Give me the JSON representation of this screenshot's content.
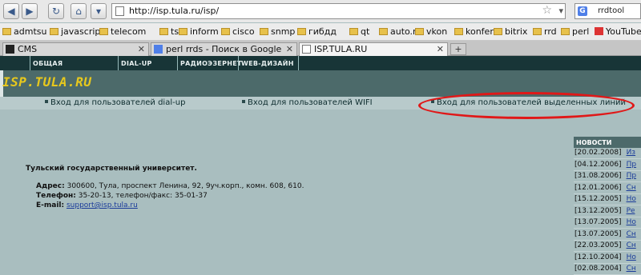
{
  "browser": {
    "url": "http://isp.tula.ru/isp/",
    "search_engine_icon": "G",
    "search_query": "rrdtool",
    "bookmarks": [
      {
        "label": "admtsu",
        "icon": "folder-icon"
      },
      {
        "label": "javascript",
        "icon": "folder-icon"
      },
      {
        "label": "telecom",
        "icon": "folder-icon"
      },
      {
        "label": "tsu",
        "icon": "folder-icon"
      },
      {
        "label": "inform",
        "icon": "folder-icon"
      },
      {
        "label": "cisco",
        "icon": "folder-icon"
      },
      {
        "label": "snmp",
        "icon": "folder-icon"
      },
      {
        "label": "гибдд",
        "icon": "folder-icon"
      },
      {
        "label": "qt",
        "icon": "folder-icon"
      },
      {
        "label": "auto.ru",
        "icon": "folder-icon"
      },
      {
        "label": "vkon",
        "icon": "folder-icon"
      },
      {
        "label": "konfer",
        "icon": "folder-icon"
      },
      {
        "label": "bitrix",
        "icon": "folder-icon"
      },
      {
        "label": "rrd",
        "icon": "folder-icon"
      },
      {
        "label": "perl",
        "icon": "folder-icon"
      },
      {
        "label": "YouTube - Брон",
        "icon": "youtube-icon"
      }
    ],
    "tabs": [
      {
        "label": "CMS"
      },
      {
        "label": "perl rrds - Поиск в Google"
      },
      {
        "label": "ISP.TULA.RU"
      }
    ],
    "new_tab_label": "+"
  },
  "site": {
    "nav": [
      {
        "label": "ОБЩАЯ ИНФОРМАЦИЯ"
      },
      {
        "label": "DIAL-UP"
      },
      {
        "label": "РАДИОЭЗЕРНЕТ"
      },
      {
        "label": "WEB-ДИЗАЙН"
      }
    ],
    "logo": "ISP.TULA.RU",
    "login_links": [
      {
        "label": "Вход для пользователей dial-up"
      },
      {
        "label": "Вход для пользователей WIFI"
      },
      {
        "label": "Вход для пользователей выделенных линий"
      }
    ],
    "university": "Тульский государственный университет.",
    "address_label": "Адрес:",
    "address": "300600, Тула, проспект Ленина, 92, 9уч.корп., комн. 608, 610.",
    "phone_label": "Телефон:",
    "phone": "35-20-13, телефон/факс: 35-01-37",
    "email_label": "E-mail:",
    "email": "support@isp.tula.ru",
    "news_header": "НОВОСТИ",
    "news": [
      {
        "date": "[20.02.2008]",
        "title": "Из"
      },
      {
        "date": "[04.12.2006]",
        "title": "Пр"
      },
      {
        "date": "[31.08.2006]",
        "title": "Пр"
      },
      {
        "date": "[12.01.2006]",
        "title": "Сн"
      },
      {
        "date": "[15.12.2005]",
        "title": "Но"
      },
      {
        "date": "[13.12.2005]",
        "title": "Ре"
      },
      {
        "date": "[13.07.2005]",
        "title": "Но"
      },
      {
        "date": "[13.07.2005]",
        "title": "Сн"
      },
      {
        "date": "[22.03.2005]",
        "title": "Сн"
      },
      {
        "date": "[12.10.2004]",
        "title": "Но"
      },
      {
        "date": "[02.08.2004]",
        "title": "Сн"
      }
    ]
  },
  "colors": {
    "page_background": "#a9bebf",
    "site_nav": "#183537",
    "logo_band": "#4c6a6a",
    "logo_text": "#e7c81d",
    "highlight_oval": "#e01818"
  }
}
